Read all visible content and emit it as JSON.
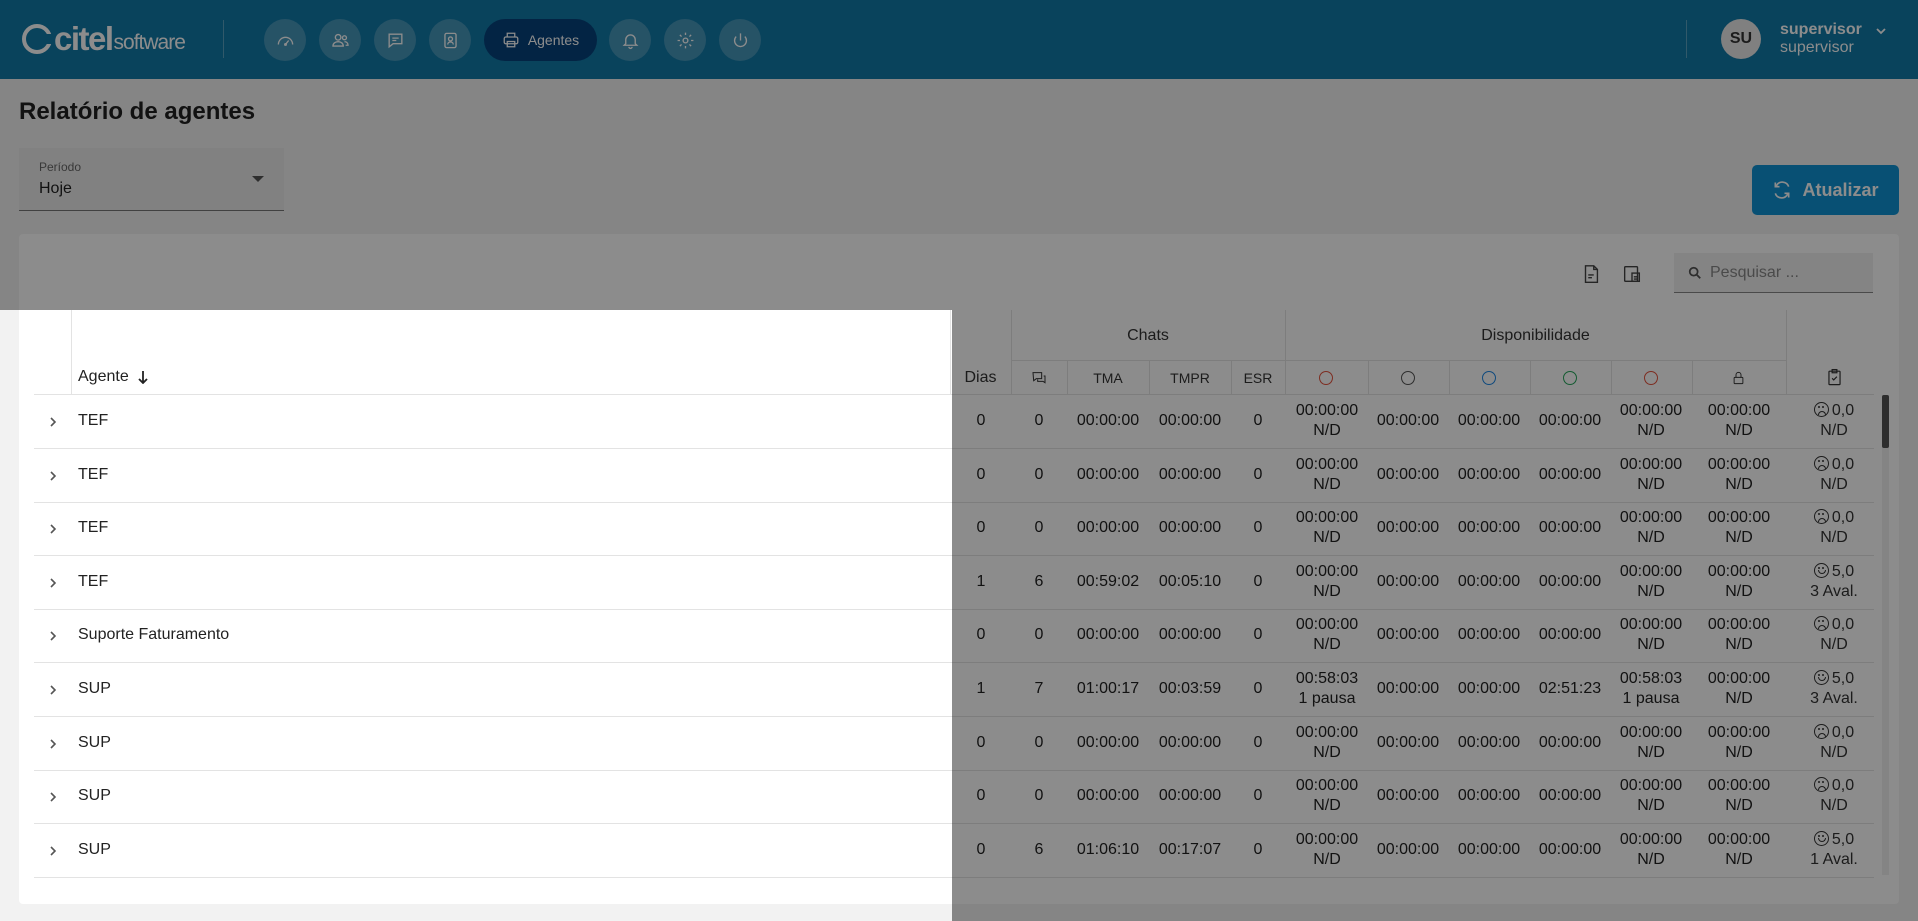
{
  "header": {
    "logo_brand": "citel",
    "logo_suffix": "software",
    "nav": [
      {
        "icon": "dashboard-gauge-icon"
      },
      {
        "icon": "users-icon"
      },
      {
        "icon": "chat-icon"
      },
      {
        "icon": "contacts-icon"
      },
      {
        "icon": "printer-icon",
        "label": "Agentes",
        "active": true
      },
      {
        "icon": "bell-icon"
      },
      {
        "icon": "gear-icon"
      },
      {
        "icon": "power-icon"
      }
    ],
    "active_label": "Agentes",
    "user": {
      "initials": "SU",
      "name": "supervisor",
      "role": "supervisor"
    }
  },
  "page": {
    "title": "Relatório de agentes",
    "period_label": "Período",
    "period_value": "Hoje",
    "refresh_label": "Atualizar",
    "search_placeholder": "Pesquisar ..."
  },
  "table": {
    "agent_header": "Agente",
    "days_header": "Dias",
    "group_chats": "Chats",
    "group_availability": "Disponibilidade",
    "col_tma": "TMA",
    "col_tmpr": "TMPR",
    "col_esr": "ESR",
    "status_colors": [
      "#e5533d",
      "#555555",
      "#1e88e5",
      "#26a65b",
      "#e5533d"
    ],
    "rows": [
      {
        "name": "TEF",
        "dias": "0",
        "chats": "0",
        "tma": "00:00:00",
        "tmpr": "00:00:00",
        "esr": "0",
        "a1": "00:00:00",
        "a1b": "N/D",
        "a2": "00:00:00",
        "a3": "00:00:00",
        "a4": "00:00:00",
        "a5": "00:00:00",
        "a5b": "N/D",
        "lock": "00:00:00",
        "lockb": "N/D",
        "mood": "sad",
        "score": "0,0",
        "evals": "N/D"
      },
      {
        "name": "TEF",
        "dias": "0",
        "chats": "0",
        "tma": "00:00:00",
        "tmpr": "00:00:00",
        "esr": "0",
        "a1": "00:00:00",
        "a1b": "N/D",
        "a2": "00:00:00",
        "a3": "00:00:00",
        "a4": "00:00:00",
        "a5": "00:00:00",
        "a5b": "N/D",
        "lock": "00:00:00",
        "lockb": "N/D",
        "mood": "sad",
        "score": "0,0",
        "evals": "N/D"
      },
      {
        "name": "TEF",
        "dias": "0",
        "chats": "0",
        "tma": "00:00:00",
        "tmpr": "00:00:00",
        "esr": "0",
        "a1": "00:00:00",
        "a1b": "N/D",
        "a2": "00:00:00",
        "a3": "00:00:00",
        "a4": "00:00:00",
        "a5": "00:00:00",
        "a5b": "N/D",
        "lock": "00:00:00",
        "lockb": "N/D",
        "mood": "sad",
        "score": "0,0",
        "evals": "N/D"
      },
      {
        "name": "TEF",
        "dias": "1",
        "chats": "6",
        "tma": "00:59:02",
        "tmpr": "00:05:10",
        "esr": "0",
        "a1": "00:00:00",
        "a1b": "N/D",
        "a2": "00:00:00",
        "a3": "00:00:00",
        "a4": "00:00:00",
        "a5": "00:00:00",
        "a5b": "N/D",
        "lock": "00:00:00",
        "lockb": "N/D",
        "mood": "happy",
        "score": "5,0",
        "evals": "3 Aval."
      },
      {
        "name": "Suporte Faturamento",
        "dias": "0",
        "chats": "0",
        "tma": "00:00:00",
        "tmpr": "00:00:00",
        "esr": "0",
        "a1": "00:00:00",
        "a1b": "N/D",
        "a2": "00:00:00",
        "a3": "00:00:00",
        "a4": "00:00:00",
        "a5": "00:00:00",
        "a5b": "N/D",
        "lock": "00:00:00",
        "lockb": "N/D",
        "mood": "sad",
        "score": "0,0",
        "evals": "N/D"
      },
      {
        "name": "SUP",
        "dias": "1",
        "chats": "7",
        "tma": "01:00:17",
        "tmpr": "00:03:59",
        "esr": "0",
        "a1": "00:58:03",
        "a1b": "1 pausa",
        "a2": "00:00:00",
        "a3": "00:00:00",
        "a4": "02:51:23",
        "a5": "00:58:03",
        "a5b": "1 pausa",
        "lock": "00:00:00",
        "lockb": "N/D",
        "mood": "happy",
        "score": "5,0",
        "evals": "3 Aval."
      },
      {
        "name": "SUP",
        "dias": "0",
        "chats": "0",
        "tma": "00:00:00",
        "tmpr": "00:00:00",
        "esr": "0",
        "a1": "00:00:00",
        "a1b": "N/D",
        "a2": "00:00:00",
        "a3": "00:00:00",
        "a4": "00:00:00",
        "a5": "00:00:00",
        "a5b": "N/D",
        "lock": "00:00:00",
        "lockb": "N/D",
        "mood": "sad",
        "score": "0,0",
        "evals": "N/D"
      },
      {
        "name": "SUP",
        "dias": "0",
        "chats": "0",
        "tma": "00:00:00",
        "tmpr": "00:00:00",
        "esr": "0",
        "a1": "00:00:00",
        "a1b": "N/D",
        "a2": "00:00:00",
        "a3": "00:00:00",
        "a4": "00:00:00",
        "a5": "00:00:00",
        "a5b": "N/D",
        "lock": "00:00:00",
        "lockb": "N/D",
        "mood": "sad",
        "score": "0,0",
        "evals": "N/D"
      },
      {
        "name": "SUP",
        "dias": "0",
        "chats": "6",
        "tma": "01:06:10",
        "tmpr": "00:17:07",
        "esr": "0",
        "a1": "00:00:00",
        "a1b": "N/D",
        "a2": "00:00:00",
        "a3": "00:00:00",
        "a4": "00:00:00",
        "a5": "00:00:00",
        "a5b": "N/D",
        "lock": "00:00:00",
        "lockb": "N/D",
        "mood": "happy",
        "score": "5,0",
        "evals": "1 Aval."
      }
    ]
  }
}
